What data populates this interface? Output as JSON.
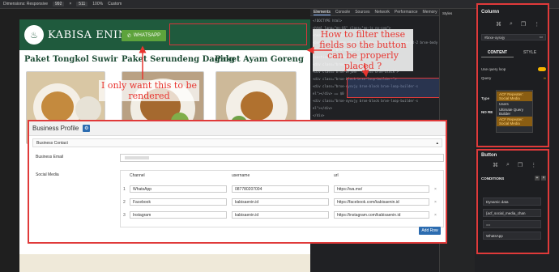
{
  "toolbar": {
    "dimensions_label": "Dimensions: Responsive",
    "width": "992",
    "height": "511",
    "zoom": "100%",
    "throttle": "Custom"
  },
  "site": {
    "brand": "KABISA ENIN",
    "whatsapp_button": "WHATSAPP",
    "packages": [
      "Paket Tongkol Suwir",
      "Paket Serundeng Daging",
      "Paket Ayam Goreng"
    ]
  },
  "annotations": {
    "left": "I only want this to be rendered",
    "right": "How to filter these fields so the button can be properly placed ?"
  },
  "profile": {
    "title": "Business Profile",
    "contact_section": "Business Contact",
    "email_label": "Business Email",
    "social_label": "Social Media",
    "columns": [
      "Channel",
      "username",
      "url"
    ],
    "rows": [
      {
        "num": "1",
        "channel": "WhatsApp",
        "username": "087780207004",
        "url": "https://wa.me/"
      },
      {
        "num": "2",
        "channel": "Facebook",
        "username": "kabisaenin.id",
        "url": "https://facebook.com/kabisaenin.id"
      },
      {
        "num": "3",
        "channel": "Instagram",
        "username": "kabisaenin.id",
        "url": "https://instagram.com/kabisaenin.id"
      }
    ],
    "add_row": "Add Row"
  },
  "devtools": {
    "tabs": [
      "Elements",
      "Console",
      "Sources",
      "Network",
      "Performance",
      "Memory"
    ],
    "code_lines": [
      "<!DOCTYPE html>",
      "<html lang=\"en-US\" class=\"no-js no-svg\">",
      "  <head>...</head>",
      "  <body class=\"home page-template-default page page-id-2 brxe-body",
      "    <header id=\"brx-header\">",
      "      <section class=\"brxe-section\">",
      "        <div class=\"brxe-container\">",
      "          <div class=\"brxe-wrjwhr\" class=\"brxe-block\">",
      "            <div class=\"brxe-block brxe-loop-builder-\">",
      "              <div class=\"brxe-oysvjy brxe-block brxe-loop-builder-s",
      "                 el\"></div> == $0",
      "              <div class=\"brxe-oysvjy brxe-block brxe-loop-builder-s",
      "                 el\"></div>",
      "            </div>",
      "          </section>",
      "        </header>",
      "        <main id=\"brx-content\">...</main>",
      "        <script id=\"bricks-scripts-js-extra\">"
    ],
    "bottom_text": "on, and navig"
  },
  "builder": {
    "column_title": "Column",
    "column_id": "#brxe-oysvjy",
    "tab_content": "CONTENT",
    "tab_style": "STYLE",
    "use_query_loop": "Use query loop",
    "query_label": "Query",
    "type_label": "Type",
    "type_value": "ACF Repeater: Social Media",
    "dropdown_items": [
      "Users",
      "Ultimate Query Builder",
      "ACF Repeater: Social Media"
    ],
    "no_results": "NO RE",
    "button_title": "Button",
    "conditions_label": "CONDITIONS",
    "conditions": [
      "Dynamic data",
      "{acf_social_media_chan",
      "==",
      "WhatsApp"
    ]
  },
  "colors": {
    "site_header": "#1f5a3d",
    "whatsapp_green": "#5da33c",
    "annotation_red": "#e8342f",
    "devtools_bg": "#202124",
    "accent_orange": "#f4b400"
  }
}
